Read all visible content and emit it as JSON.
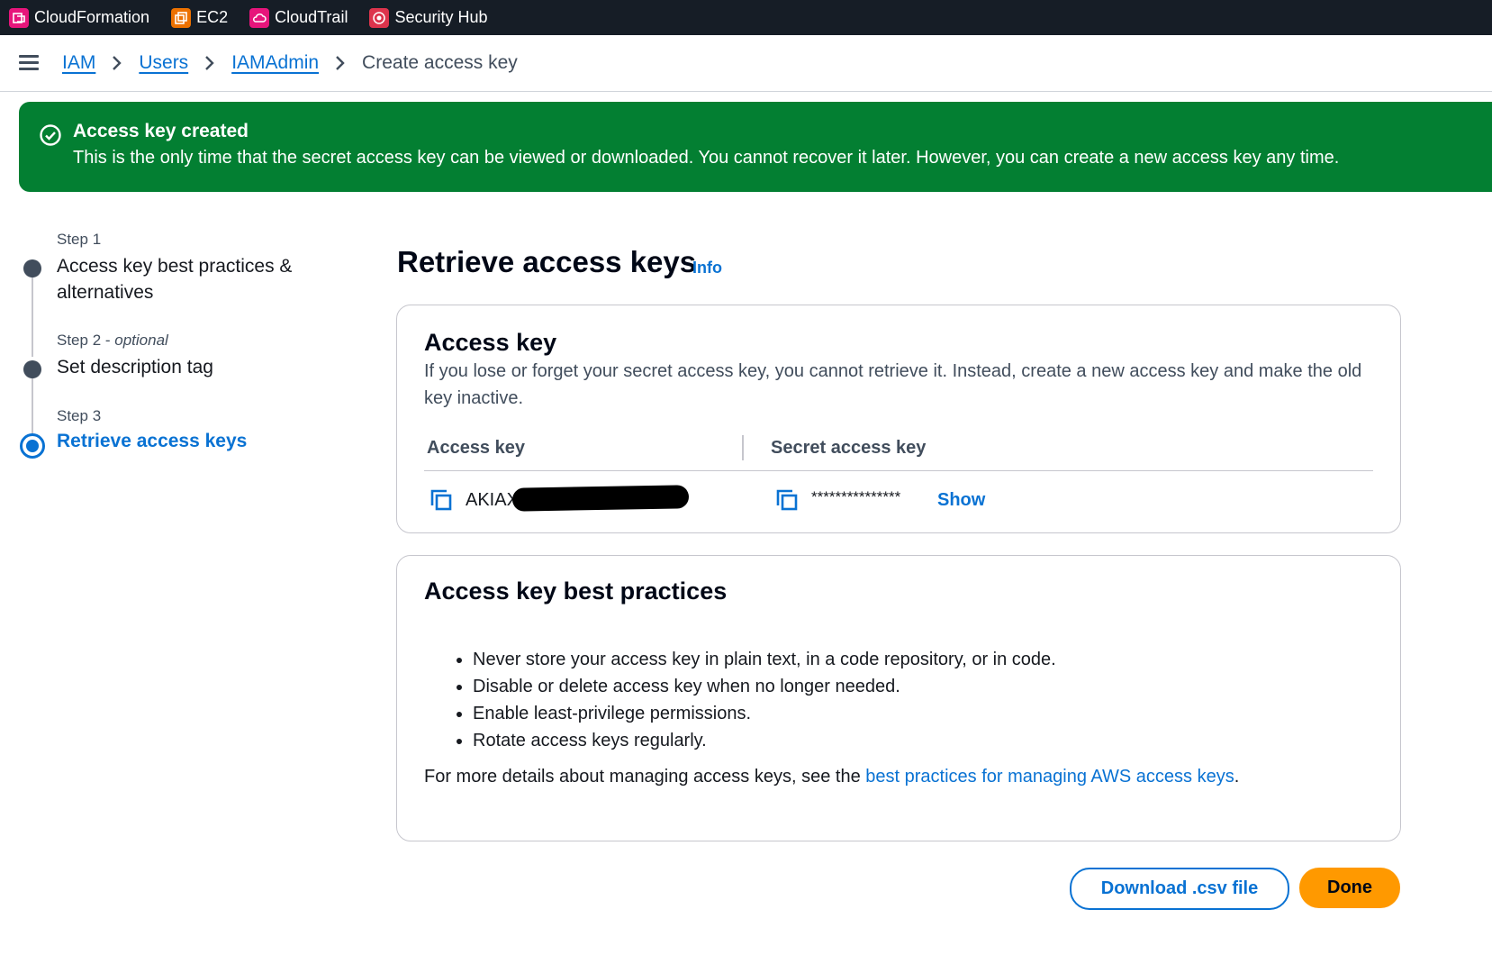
{
  "favorites": [
    {
      "label": "CloudFormation",
      "icon": "cloudformation-icon",
      "color": "#e7157b"
    },
    {
      "label": "EC2",
      "icon": "ec2-icon",
      "color": "#ed7100"
    },
    {
      "label": "CloudTrail",
      "icon": "cloudtrail-icon",
      "color": "#e7157b"
    },
    {
      "label": "Security Hub",
      "icon": "security-hub-icon",
      "color": "#dd344c"
    }
  ],
  "breadcrumb": {
    "items": [
      "IAM",
      "Users",
      "IAMAdmin"
    ],
    "current": "Create access key"
  },
  "flash": {
    "title": "Access key created",
    "message": "This is the only time that the secret access key can be viewed or downloaded. You cannot recover it later. However, you can create a new access key any time.",
    "color": "#037f32"
  },
  "steps": [
    {
      "number": "Step 1",
      "optional": "",
      "label_line1": "Access key best practices &",
      "label_line2": "alternatives"
    },
    {
      "number": "Step 2 - ",
      "optional": "optional",
      "label_line1": "Set description tag",
      "label_line2": ""
    },
    {
      "number": "Step 3",
      "optional": "",
      "label_line1": "Retrieve access keys",
      "label_line2": ""
    }
  ],
  "page": {
    "title": "Retrieve access keys",
    "info": "Info"
  },
  "access_key_card": {
    "title": "Access key",
    "description": "If you lose or forget your secret access key, you cannot retrieve it. Instead, create a new access key and make the old key inactive.",
    "col_access_key": "Access key",
    "col_secret_key": "Secret access key",
    "access_key_value": "AKIAX",
    "secret_key_value": "***************",
    "show_label": "Show"
  },
  "best_practices_card": {
    "title": "Access key best practices",
    "items": [
      "Never store your access key in plain text, in a code repository, or in code.",
      "Disable or delete access key when no longer needed.",
      "Enable least-privilege permissions.",
      "Rotate access keys regularly."
    ],
    "more_prefix": "For more details about managing access keys, see the ",
    "more_link": "best practices for managing AWS access keys",
    "more_suffix": "."
  },
  "buttons": {
    "download": "Download .csv file",
    "done": "Done"
  },
  "colors": {
    "accent": "#0972d3",
    "primary_button": "#ff9900",
    "topbar": "#161d26"
  }
}
